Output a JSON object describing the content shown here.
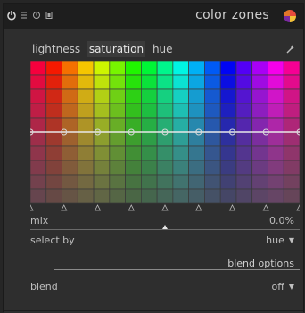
{
  "module": {
    "title": "color zones",
    "header_icons": [
      "power-icon",
      "menu-icon",
      "reset-icon",
      "presets-icon"
    ]
  },
  "tabs": [
    {
      "label": "lightness",
      "active": false
    },
    {
      "label": "saturation",
      "active": true
    },
    {
      "label": "hue",
      "active": false
    }
  ],
  "picker_icon": "color-picker-icon",
  "graph": {
    "curve_level": 0.5,
    "node_count": 8
  },
  "mix": {
    "label": "mix",
    "value": "0.0%",
    "fraction": 0.0
  },
  "select_by": {
    "label": "select by",
    "value": "hue"
  },
  "blend_options": {
    "label": "blend options"
  },
  "blend": {
    "label": "blend",
    "value": "off"
  },
  "colors": {
    "background": "#2e2e2e",
    "header": "#1e1e1e",
    "curve": "#e8e8e8"
  }
}
